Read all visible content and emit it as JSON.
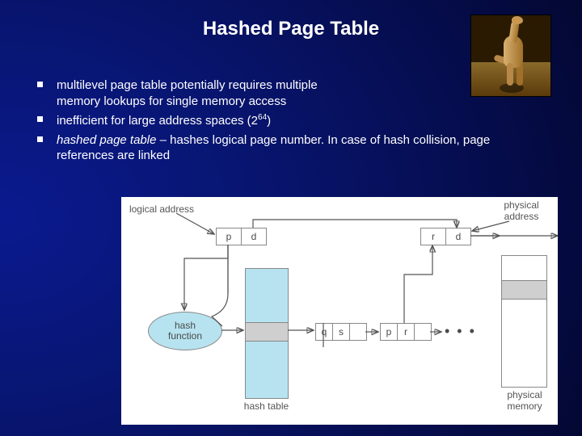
{
  "title": "Hashed Page Table",
  "corner_caption": "",
  "bullets": {
    "b1a": "multilevel page table potentially requires multiple",
    "b1b": "memory lookups for single memory access",
    "b2a": "inefficient for large address spaces (2",
    "b2sup": "64",
    "b2b": ")",
    "b3a": "hashed page table",
    "b3b": " – hashes logical page number. In case of hash collision, page references are linked"
  },
  "diagram": {
    "logical_label": "logical address",
    "physical_label": "physical\naddress",
    "p": "p",
    "d": "d",
    "r": "r",
    "hash_fn": "hash\nfunction",
    "hash_table": "hash table",
    "phys_mem": "physical\nmemory",
    "q": "q",
    "s": "s",
    "dots": "• • •"
  }
}
